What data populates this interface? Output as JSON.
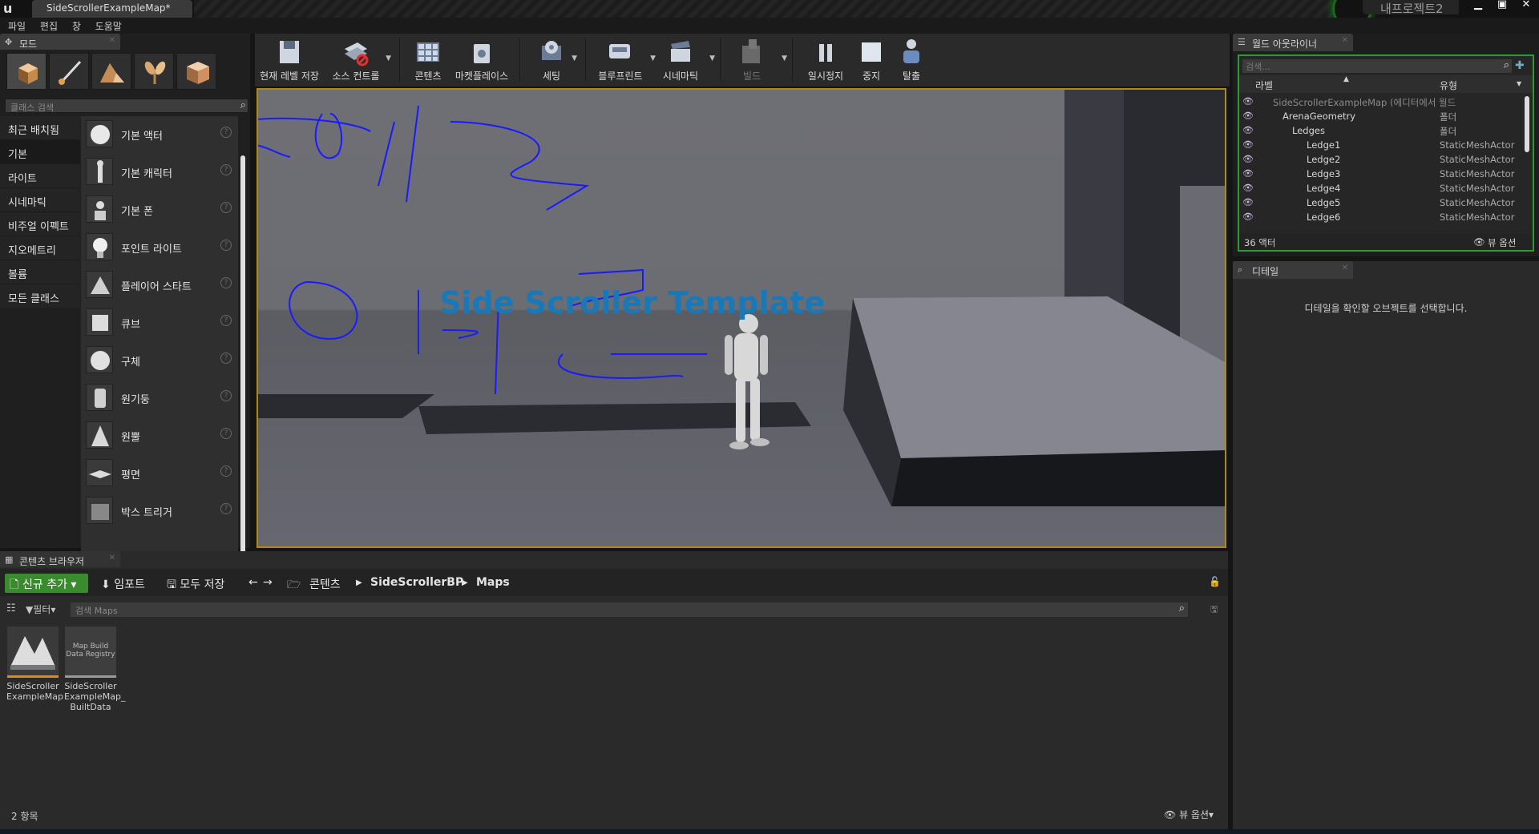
{
  "titlebar": {
    "tab_title": "SideScrollerExampleMap*",
    "project_name": "내프로젝트2",
    "minimize": "▁",
    "restore": "▣",
    "close": "✕"
  },
  "menubar": {
    "items": [
      "파일",
      "편집",
      "창",
      "도움말"
    ]
  },
  "modes": {
    "tab_label": "모드",
    "search_placeholder": "클래스 검색",
    "categories": [
      "최근 배치됨",
      "기본",
      "라이트",
      "시네마틱",
      "비주얼 이펙트",
      "지오메트리",
      "볼륨",
      "모든 클래스"
    ],
    "selected_category": "기본",
    "items": [
      "기본 액터",
      "기본 캐릭터",
      "기본 폰",
      "포인트 라이트",
      "플레이어 스타트",
      "큐브",
      "구체",
      "원기둥",
      "원뿔",
      "평면",
      "박스 트리거"
    ],
    "help": "?"
  },
  "toolbar": {
    "save": "현재 레벨 저장",
    "source_control": "소스 컨트롤",
    "content": "콘텐츠",
    "marketplace": "마켓플레이스",
    "settings": "세팅",
    "blueprints": "블루프린트",
    "cinematics": "시네마틱",
    "build": "빌드",
    "pause": "일시정지",
    "stop": "중지",
    "eject": "탈출"
  },
  "viewport": {
    "overlay_title": "Side Scroller Template"
  },
  "outliner": {
    "tab_label": "월드 아웃라이너",
    "search_placeholder": "검색...",
    "col_label": "라벨",
    "col_type": "유형",
    "rows": [
      {
        "name": "SideScrollerExampleMap (에디터에서 월드",
        "type": ""
      },
      {
        "name": "ArenaGeometry",
        "type": "폴더"
      },
      {
        "name": "Ledges",
        "type": "폴더"
      },
      {
        "name": "Ledge1",
        "type": "StaticMeshActor"
      },
      {
        "name": "Ledge2",
        "type": "StaticMeshActor"
      },
      {
        "name": "Ledge3",
        "type": "StaticMeshActor"
      },
      {
        "name": "Ledge4",
        "type": "StaticMeshActor"
      },
      {
        "name": "Ledge5",
        "type": "StaticMeshActor"
      },
      {
        "name": "Ledge6",
        "type": "StaticMeshActor"
      }
    ],
    "actor_count": "36 액터",
    "view_options": "뷰 옵션"
  },
  "details": {
    "tab_label": "디테일",
    "empty_message": "디테일을 확인할 오브젝트를 선택합니다."
  },
  "content_browser": {
    "tab_label": "콘텐츠 브라우저",
    "add_new": "신규 추가",
    "import": "임포트",
    "save_all": "모두 저장",
    "path": [
      "콘텐츠",
      "SideScrollerBP",
      "Maps"
    ],
    "filter": "필터",
    "search_placeholder": "검색 Maps",
    "assets": [
      {
        "name": "SideScroller ExampleMap",
        "thumb_text": ""
      },
      {
        "name": "SideScroller ExampleMap_ BuiltData",
        "thumb_text": "Map Build Data Registry"
      }
    ],
    "item_count": "2 항목",
    "view_options": "뷰 옵션"
  },
  "colors": {
    "accent_green": "#3a8a2e",
    "viewport_border": "#b08a10",
    "overlay_text": "#1978b8",
    "annotation_ink": "#1a1aff"
  }
}
